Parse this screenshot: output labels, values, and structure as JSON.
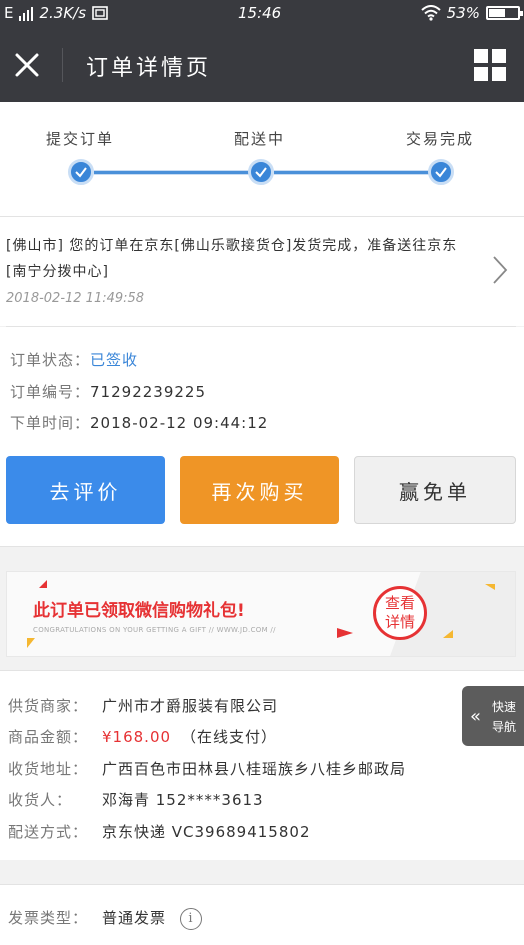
{
  "status_bar": {
    "carrier": "E",
    "speed": "2.3K/s",
    "time": "15:46",
    "battery": "53%"
  },
  "header": {
    "title": "订单详情页"
  },
  "progress": {
    "steps": [
      "提交订单",
      "配送中",
      "交易完成"
    ]
  },
  "logistics": {
    "message": "[佛山市] 您的订单在京东[佛山乐歌接货仓]发货完成，准备送往京东[南宁分拨中心]",
    "time": "2018-02-12 11:49:58"
  },
  "order": {
    "status_label": "订单状态：",
    "status_value": "已签收",
    "number_label": "订单编号：",
    "number_value": "71292239225",
    "time_label": "下单时间：",
    "time_value": "2018-02-12 09:44:12"
  },
  "buttons": {
    "review": "去评价",
    "rebuy": "再次购买",
    "free": "赢免单"
  },
  "banner": {
    "headline": "此订单已领取微信购物礼包!",
    "sub": "CONGRATULATIONS ON YOUR GETTING A GIFT // WWW.JD.COM //",
    "cta_line1": "查看",
    "cta_line2": "详情"
  },
  "details": {
    "seller_label": "供货商家：",
    "seller_value": "广州市才爵服装有限公司",
    "amount_label": "商品金额：",
    "amount_value": "¥168.00",
    "amount_note": "（在线支付）",
    "address_label": "收货地址：",
    "address_value": "广西百色市田林县八桂瑶族乡八桂乡邮政局",
    "receiver_label": "收货人：",
    "receiver_value": "邓海青  152****3613",
    "delivery_label": "配送方式：",
    "delivery_value": "京东快递  VC39689415802"
  },
  "quick_nav": {
    "label": "快速导航"
  },
  "invoice": {
    "type_label": "发票类型：",
    "type_value": "普通发票"
  },
  "colors": {
    "accent_blue": "#3b8bea",
    "accent_orange": "#ef9526",
    "price_red": "#e63234",
    "header_bg": "#393a3f"
  }
}
